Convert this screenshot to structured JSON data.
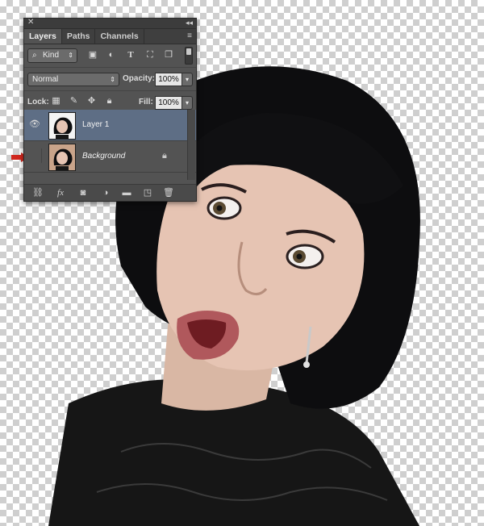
{
  "panel": {
    "close_glyph": "✕",
    "collapse_glyph": "◂◂",
    "tabs": [
      {
        "label": "Layers",
        "active": true
      },
      {
        "label": "Paths",
        "active": false
      },
      {
        "label": "Channels",
        "active": false
      }
    ],
    "menu_glyph": "≡",
    "filter": {
      "label": "Kind",
      "icons": [
        "image-filter-icon",
        "adjustment-filter-icon",
        "type-filter-icon",
        "shape-filter-icon",
        "smart-object-filter-icon"
      ]
    },
    "blend_mode": "Normal",
    "opacity_label": "Opacity:",
    "opacity_value": "100%",
    "lock_label": "Lock:",
    "fill_label": "Fill:",
    "fill_value": "100%",
    "layers": [
      {
        "name": "Layer 1",
        "visible": true,
        "selected": true,
        "locked": false
      },
      {
        "name": "Background",
        "visible": false,
        "selected": false,
        "locked": true
      }
    ],
    "bottom_icons": [
      "link-layers-icon",
      "fx-icon",
      "add-mask-icon",
      "adjustment-layer-icon",
      "new-group-icon",
      "new-layer-icon",
      "delete-layer-icon"
    ],
    "fx_label": "fx"
  },
  "colors": {
    "panel_bg": "#535353",
    "selected_layer": "#5e6e85",
    "arrow": "#d0271e"
  }
}
